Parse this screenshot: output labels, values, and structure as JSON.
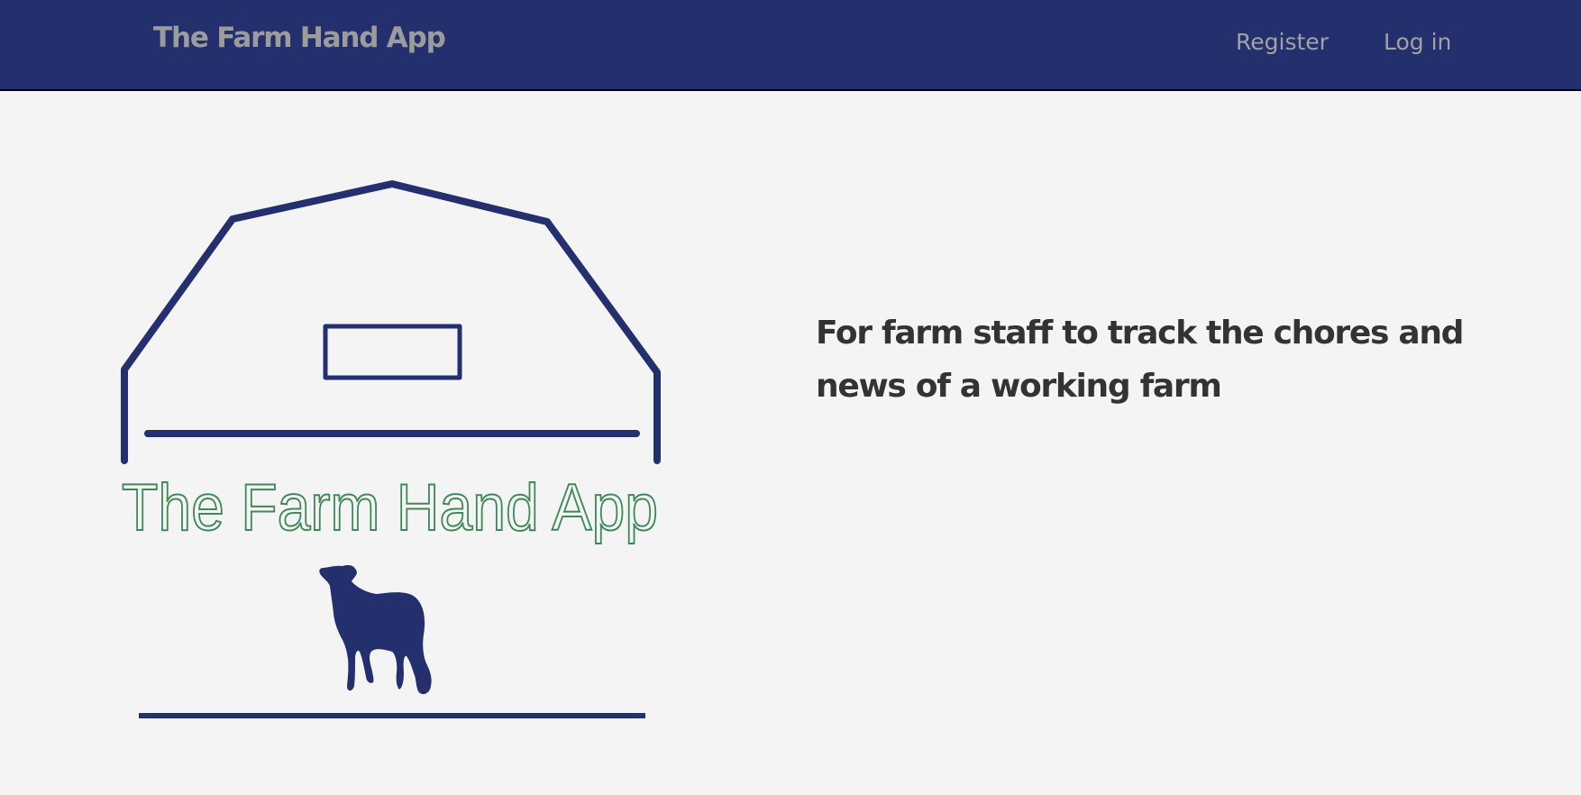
{
  "header": {
    "brand": "The Farm Hand App",
    "nav": {
      "register_label": "Register",
      "login_label": "Log in"
    }
  },
  "logo": {
    "title": "The Farm Hand App",
    "icons": [
      "barn-icon",
      "sheep-icon"
    ]
  },
  "main": {
    "tagline": "For farm staff to track the chores and news of a working farm"
  },
  "colors": {
    "navbar_bg": "#24306e",
    "brand_text": "#9c9c9c",
    "nav_link": "#a2a2a6",
    "page_bg": "#f4f4f4",
    "logo_navy": "#24306e",
    "logo_text_outline": "#3f8858",
    "tagline_text": "#333333"
  }
}
